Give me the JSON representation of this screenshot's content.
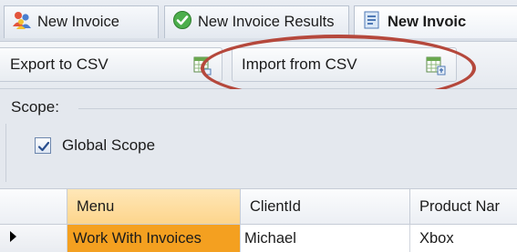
{
  "tabs": [
    {
      "label": "New Invoice",
      "icon": "users-icon"
    },
    {
      "label": "New Invoice Results",
      "icon": "check-circle-icon"
    },
    {
      "label": "New Invoic",
      "icon": "invoice-icon"
    }
  ],
  "toolbar": {
    "export_label": "Export to CSV",
    "import_label": "Import from CSV",
    "export_icon": "spreadsheet-export-icon",
    "import_icon": "spreadsheet-import-icon"
  },
  "scope": {
    "title": "Scope:",
    "checkbox_label": "Global Scope",
    "checked": true
  },
  "grid": {
    "columns": [
      "Menu",
      "ClientId",
      "Product Nar"
    ],
    "rows": [
      [
        "Work With Invoices",
        "Michael",
        "Xbox"
      ]
    ]
  },
  "colors": {
    "highlight_ellipse": "#b5483c",
    "selected_cell": "#f4a020",
    "selected_header": "#fdd58c"
  }
}
